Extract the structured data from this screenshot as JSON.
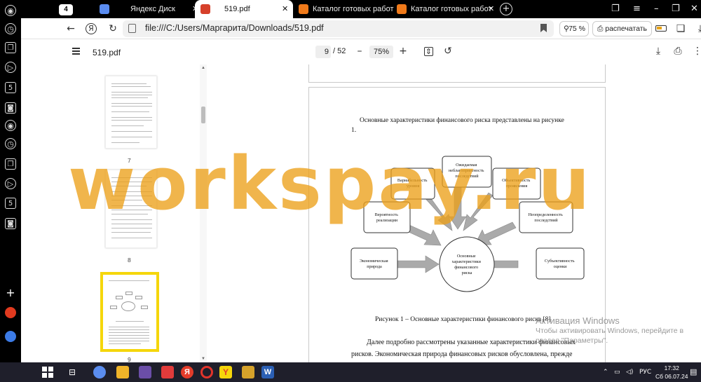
{
  "browser": {
    "tabs": [
      {
        "label": "4",
        "kind": "tab-group"
      },
      {
        "label": "Яндекс Диск"
      },
      {
        "label": "519.pdf",
        "active": true
      },
      {
        "label": "Каталог готовых работ"
      },
      {
        "label": "Каталог готовых работ"
      }
    ],
    "address": "file:///C:/Users/Маргарита/Downloads/519.pdf",
    "zoom": "75 %",
    "print_label": "распечатать"
  },
  "pdf_viewer": {
    "filename": "519.pdf",
    "current_page": "9",
    "total_pages": "/ 52",
    "zoom": "75%",
    "thumbnail_labels": [
      "7",
      "8",
      "9"
    ],
    "selected_thumbnail": "9"
  },
  "page": {
    "intro_line1": "Основные характеристики финансового риска представлены на рисунке",
    "intro_line2": "1.",
    "diagram": {
      "center": [
        "Основные",
        "характеристики",
        "финансового",
        "риска"
      ],
      "nodes": [
        {
          "lines": [
            "Экономическая",
            "природа"
          ]
        },
        {
          "lines": [
            "Вероятность",
            "реализации"
          ]
        },
        {
          "lines": [
            "Вариабельность",
            "уровня"
          ]
        },
        {
          "lines": [
            "Ожидаемая",
            "неблагоприятность",
            "последствий"
          ]
        },
        {
          "lines": [
            "Объективность",
            "проявления"
          ]
        },
        {
          "lines": [
            "Неопределенность",
            "последствий"
          ]
        },
        {
          "lines": [
            "Субъективность",
            "оценки"
          ]
        }
      ]
    },
    "caption": "Рисунок 1 – Основные характеристики финансового риска [8]",
    "body_line1": "Далее подробно рассмотрены указанные характеристики финансовых",
    "body_line2": "рисков. Экономическая природа финансовых рисков обусловлена, прежде"
  },
  "watermark": "workspay.ru",
  "windows_activation": {
    "title": "Активация Windows",
    "subtitle_line1": "Чтобы активировать Windows, перейдите в",
    "subtitle_line2": "раздел \"Параметры\"."
  },
  "taskbar": {
    "language": "РУС",
    "time": "17:32",
    "date": "Сб 06.07.24"
  },
  "colors": {
    "watermark": "#eca019",
    "selected_thumbnail_border": "#f5d60b",
    "taskbar": "#1f1f2b",
    "tabstrip": "#000000"
  }
}
